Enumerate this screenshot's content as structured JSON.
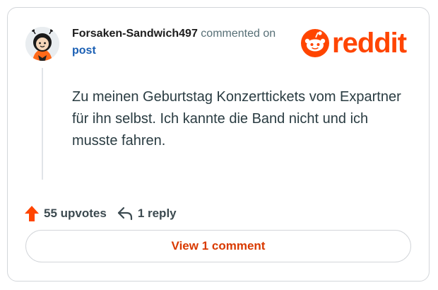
{
  "comment": {
    "author": "Forsaken-Sandwich497",
    "action_text": "commented on",
    "target_label": "post",
    "body": "Zu meinen Geburtstag Konzerttickets vom Expartner für ihn selbst. Ich kannte die Band nicht und ich musste fahren."
  },
  "brand": {
    "wordmark": "reddit",
    "color": "#ff4500"
  },
  "actions": {
    "upvotes_label": "55 upvotes",
    "replies_label": "1 reply",
    "upvote_icon": "upvote-arrow-icon",
    "reply_icon": "reply-arrow-icon"
  },
  "footer": {
    "view_comments_label": "View 1 comment"
  },
  "colors": {
    "accent": "#ff4500",
    "view_button_text": "#d93a00",
    "link": "#1a5fb4"
  }
}
